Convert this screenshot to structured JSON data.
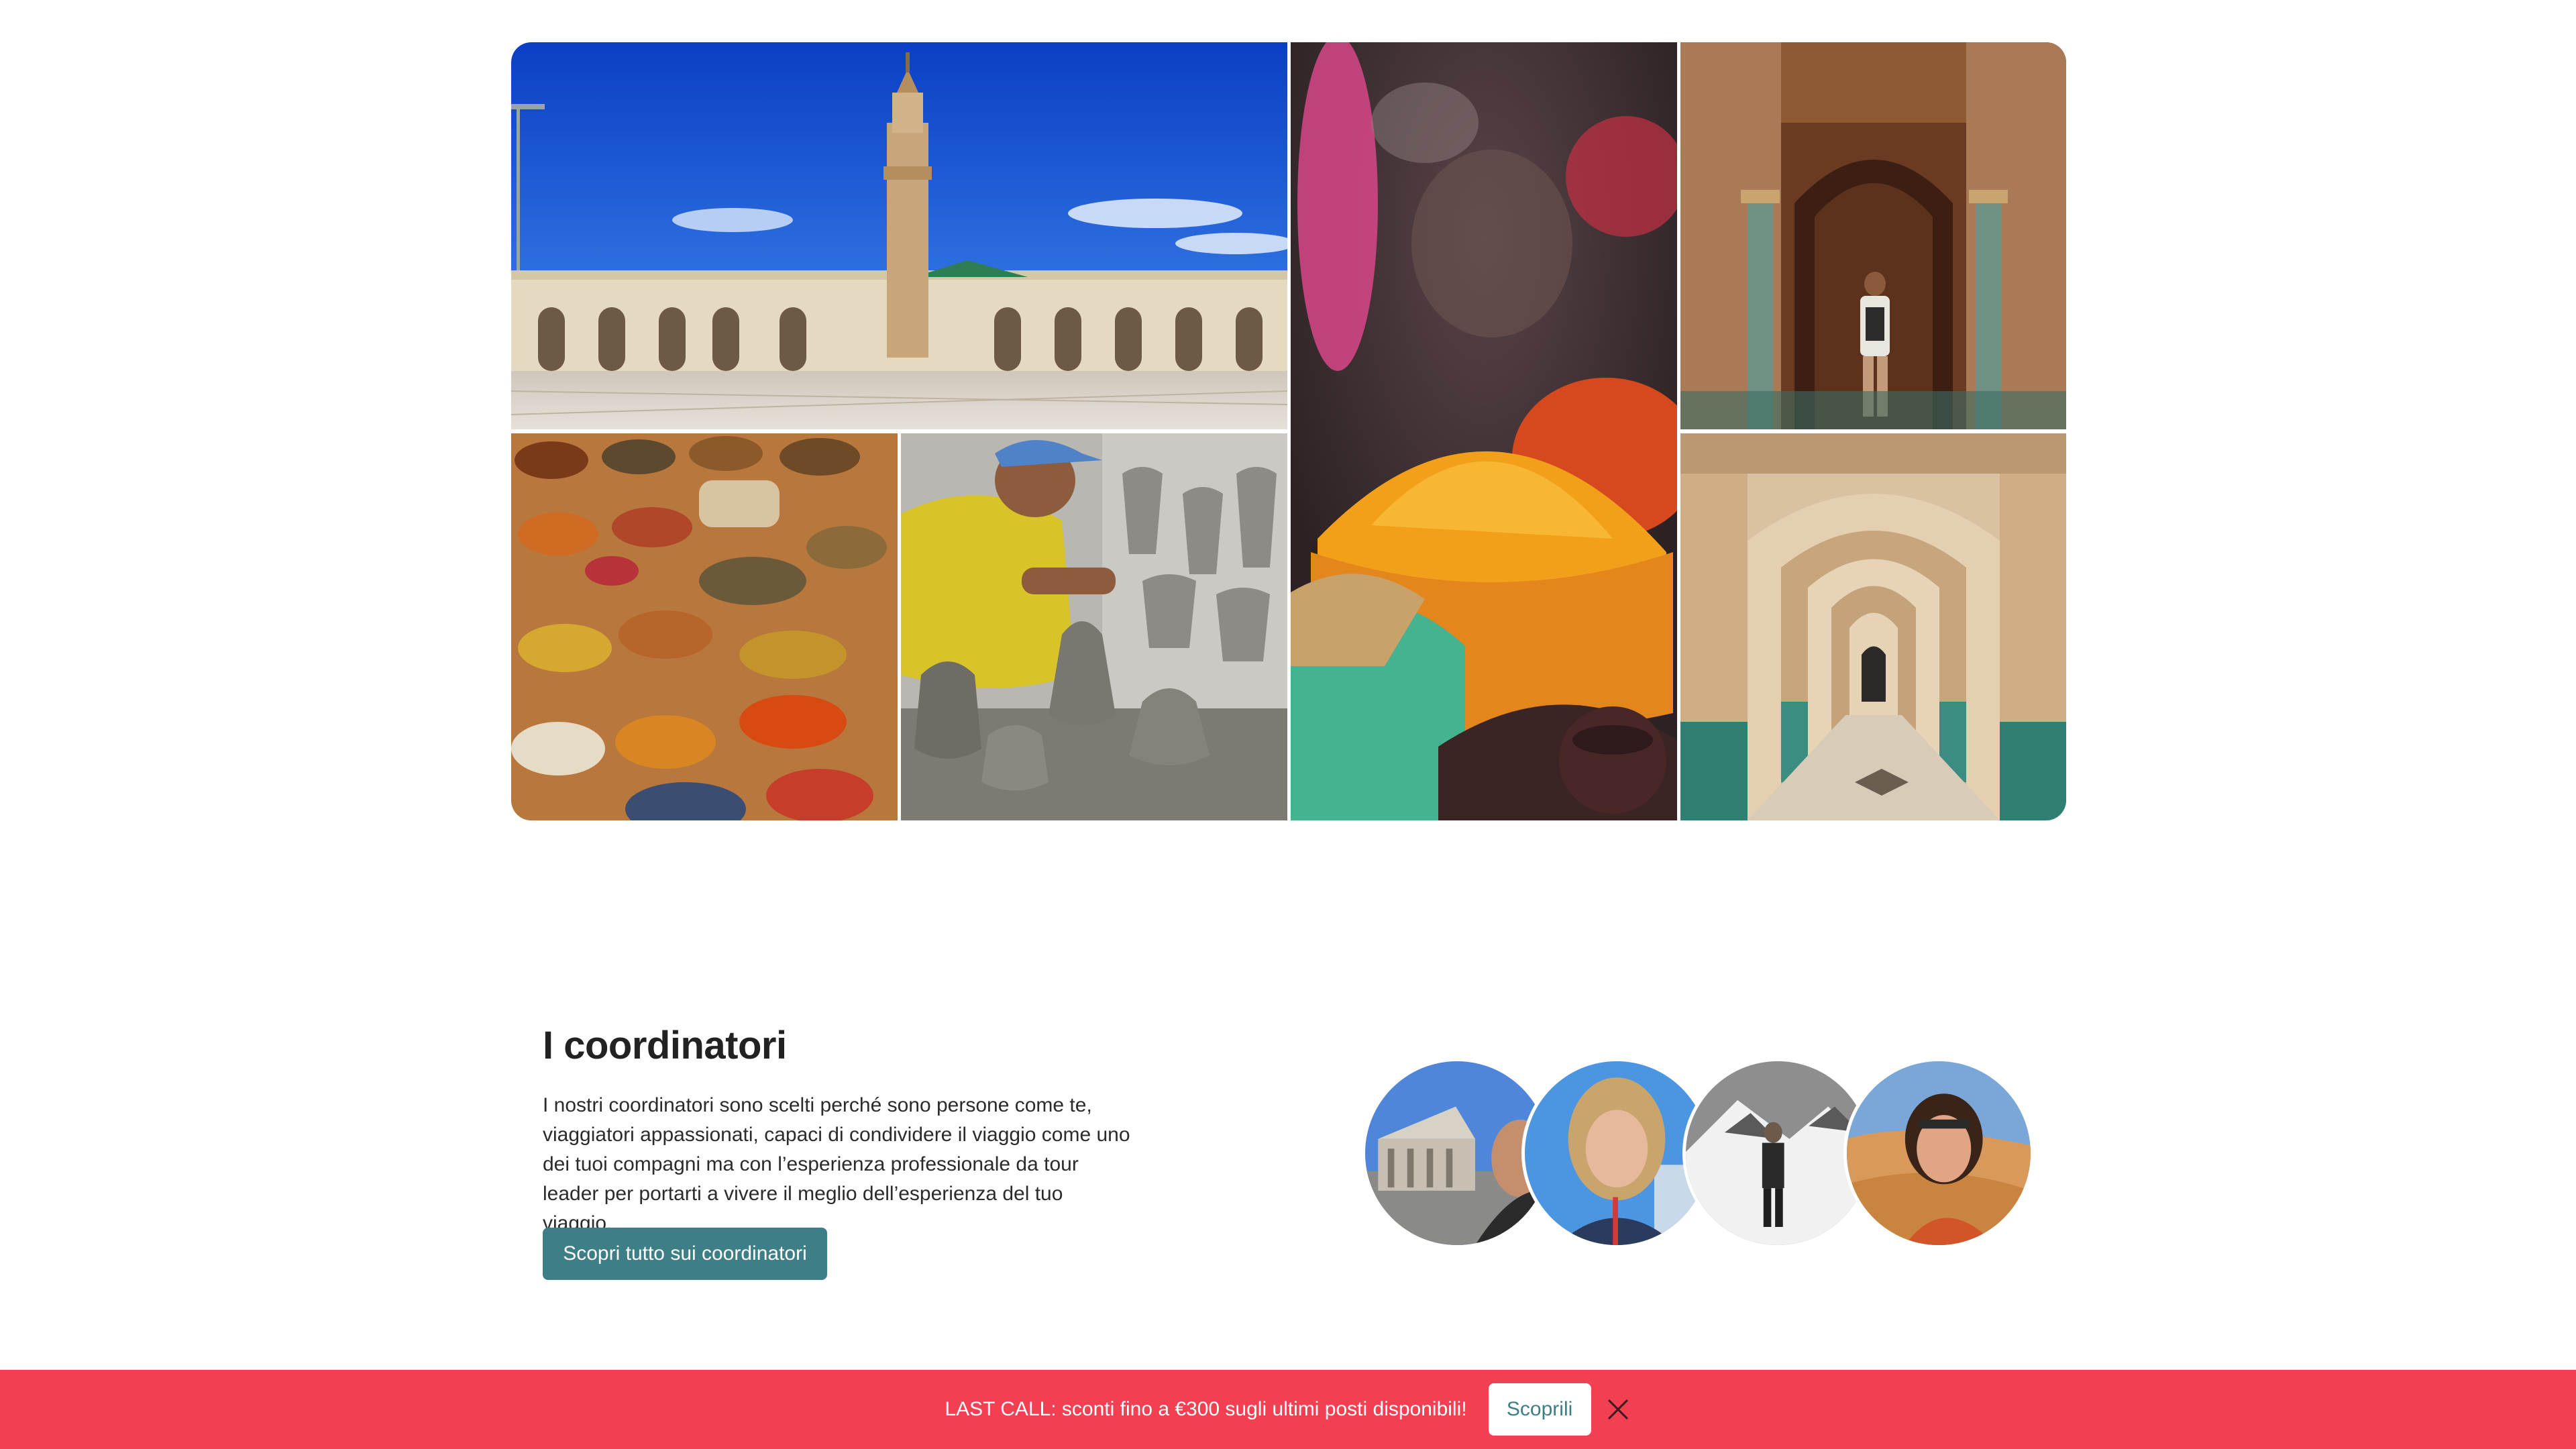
{
  "gallery": {
    "images": [
      {
        "name": "hassan-ii-mosque-photo"
      },
      {
        "name": "spice-market-photo"
      },
      {
        "name": "carved-doorway-photo"
      },
      {
        "name": "tannery-dye-pits-photo"
      },
      {
        "name": "potter-workshop-photo"
      },
      {
        "name": "tiled-arcade-photo"
      }
    ]
  },
  "coordinators": {
    "title": "I coordinatori",
    "description": "I nostri coordinatori sono scelti perché sono persone come te, viaggiatori appassionati, capaci di condividere il viaggio come uno dei tuoi compagni ma con l’esperienza professionale da tour leader per portarti a vivere il meglio dell’esperienza del tuo viaggio.",
    "button_label": "Scopri tutto sui coordinatori",
    "button_color": "#3e7e86"
  },
  "promo": {
    "text": "LAST CALL: sconti fino a €300 sugli ultimi posti disponibili!",
    "button_label": "Scoprili",
    "close_icon": "close-icon",
    "background_color": "#f33f52"
  }
}
